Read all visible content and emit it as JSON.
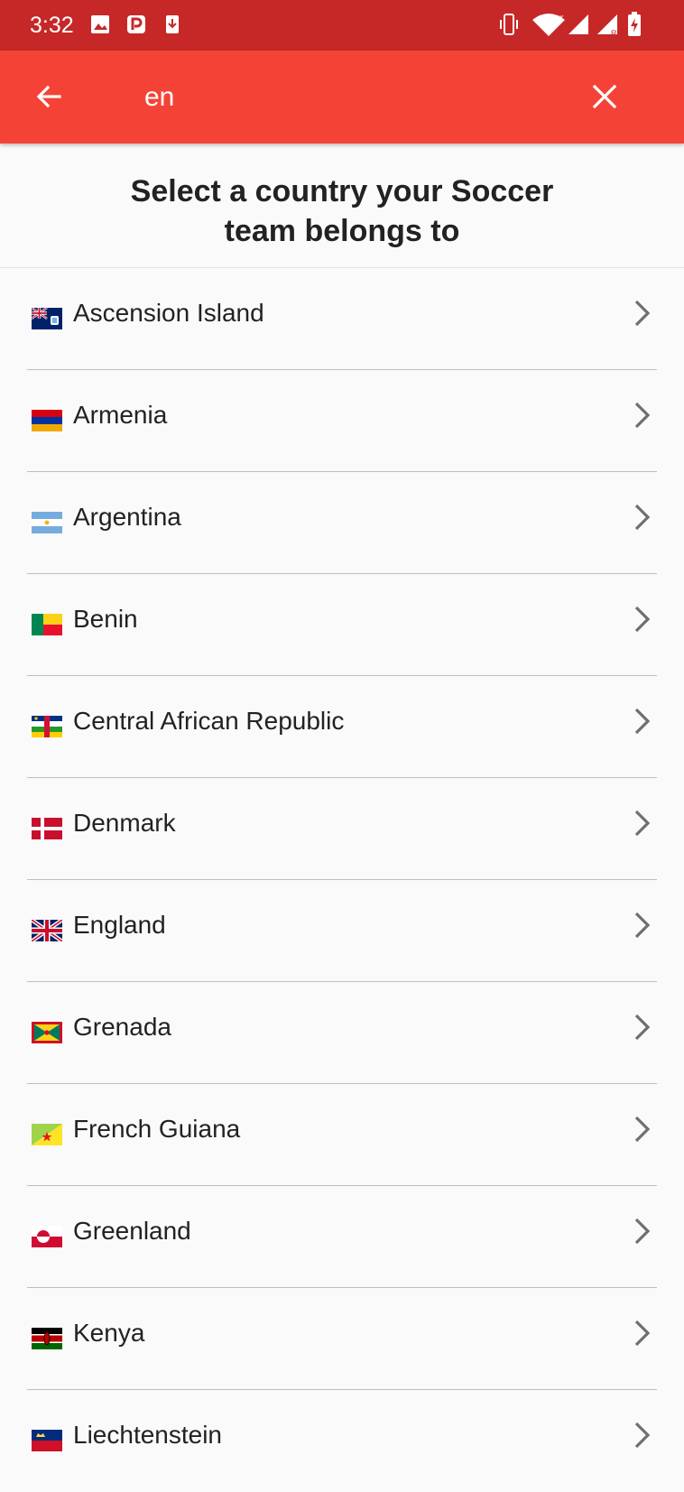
{
  "status_bar": {
    "time": "3:32",
    "left_icons": [
      "image-icon",
      "p-icon",
      "download-icon"
    ],
    "right_icons": [
      "vibrate-icon",
      "wifi-icon",
      "signal-icon",
      "signal-roaming-icon",
      "battery-charging-icon"
    ]
  },
  "toolbar": {
    "back_icon": "arrow-left-icon",
    "search_value": "en",
    "clear_icon": "close-icon",
    "color": "#f44336"
  },
  "status_bar_color": "#c62828",
  "heading": {
    "line1": "Select a country your Soccer",
    "line2": "team belongs to"
  },
  "countries": [
    {
      "name": "Ascension Island",
      "flag": "ascension-island-flag-icon"
    },
    {
      "name": "Armenia",
      "flag": "armenia-flag-icon"
    },
    {
      "name": "Argentina",
      "flag": "argentina-flag-icon"
    },
    {
      "name": "Benin",
      "flag": "benin-flag-icon"
    },
    {
      "name": "Central African Republic",
      "flag": "central-african-republic-flag-icon"
    },
    {
      "name": "Denmark",
      "flag": "denmark-flag-icon"
    },
    {
      "name": "England",
      "flag": "england-flag-icon"
    },
    {
      "name": "Grenada",
      "flag": "grenada-flag-icon"
    },
    {
      "name": "French Guiana",
      "flag": "french-guiana-flag-icon"
    },
    {
      "name": "Greenland",
      "flag": "greenland-flag-icon"
    },
    {
      "name": "Kenya",
      "flag": "kenya-flag-icon"
    },
    {
      "name": "Liechtenstein",
      "flag": "liechtenstein-flag-icon"
    }
  ]
}
